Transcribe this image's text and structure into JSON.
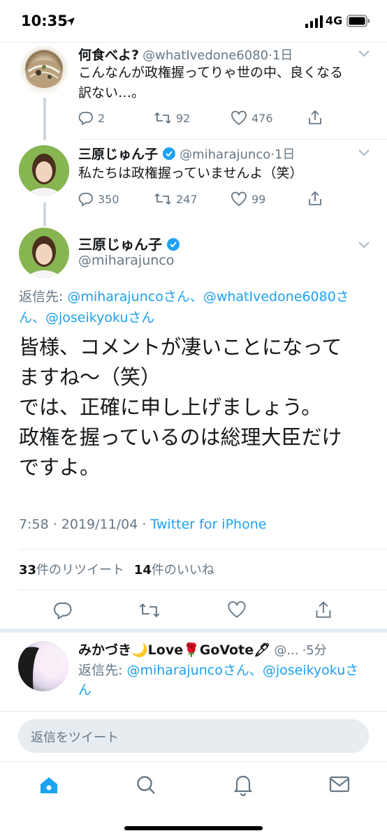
{
  "status": {
    "time": "10:35",
    "network": "4G"
  },
  "thread": [
    {
      "name": "何食べよ?",
      "handle": "@whatIvedone6080",
      "age": "·1日",
      "lines": [
        "こんなんが政権握ってりゃ世の中、良くなる",
        "訳ない…。"
      ],
      "replies": "2",
      "retweets": "92",
      "likes": "476"
    },
    {
      "name": "三原じゅん子",
      "handle": "@miharajunco",
      "age": "·1日",
      "lines": [
        "私たちは政権握っていませんよ（笑）"
      ],
      "replies": "350",
      "retweets": "247",
      "likes": "99"
    }
  ],
  "main": {
    "name": "三原じゅん子",
    "handle": "@miharajunco",
    "reply_label": "返信先: ",
    "reply_to_1": "@miharajuncoさん、@whatIvedone6080さ",
    "reply_to_2": "ん、@joseikyokuさん",
    "lines": [
      "皆様、コメントが凄いことになって",
      "ますね〜（笑）",
      "では、正確に申し上げましょう。",
      "政権を握っているのは総理大臣だけ",
      "ですよ。"
    ],
    "time_date": "7:58 · 2019/11/04 · ",
    "source": "Twitter for iPhone",
    "retweet_count": "33",
    "retweet_label": "件のリツイート",
    "like_count": "14",
    "like_label": "件のいいね"
  },
  "next_reply": {
    "name": "みかづき🌙Love🌹GoVote🖋",
    "handle": "@...",
    "age": "·5分",
    "reply_label": "返信先: ",
    "reply_to_1": "@miharajuncoさん、@joseikyokuさ",
    "reply_to_2": "ん"
  },
  "composer": {
    "placeholder": "返信をツイート"
  },
  "tabs": [
    "home",
    "search",
    "notifications",
    "messages"
  ],
  "colors": {
    "accent": "#1da1f2",
    "secondary": "#657786",
    "divider": "#e6ecf0"
  }
}
